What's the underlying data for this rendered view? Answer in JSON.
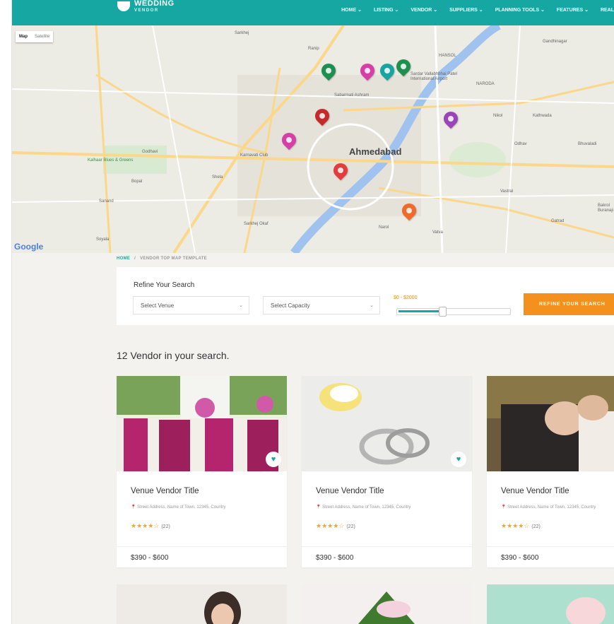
{
  "brand": {
    "name": "WEDDING",
    "sub": "VENDOR"
  },
  "nav": [
    {
      "label": "HOME ⌄"
    },
    {
      "label": "LISTING ⌄"
    },
    {
      "label": "VENDOR ⌄"
    },
    {
      "label": "SUPPLIERS ⌄"
    },
    {
      "label": "PLANNING TOOLS ⌄"
    },
    {
      "label": "FEATURES ⌄"
    },
    {
      "label": "REAL"
    }
  ],
  "map": {
    "toggle": {
      "map": "Map",
      "satellite": "Satellite"
    },
    "city": "Ahmedabad",
    "places": [
      "Sarkhej Okaf",
      "Karnavati Club",
      "Sabarmati Ashram",
      "Sardar Vallabhbhai Patel International Airport",
      "NARODA",
      "HANSOL",
      "Kathwada",
      "Bhuvaladi",
      "Vastral",
      "Gatrad",
      "Bakrol Buranaji",
      "Sanand",
      "Kalhaar Blues & Greens",
      "Godhavi",
      "Bopal",
      "Shela",
      "Soyala",
      "Sarkhej",
      "Gandhinagar",
      "Ranip",
      "Odhav",
      "Nikol",
      "Vatva",
      "Narol"
    ],
    "attribution": "Google",
    "pins": [
      {
        "color": "#1e8f4e",
        "icon": "pin-icon"
      },
      {
        "color": "#d63fa6",
        "icon": "pin-icon"
      },
      {
        "color": "#18a4a0",
        "icon": "pin-icon"
      },
      {
        "color": "#1e8f4e",
        "icon": "pin-icon"
      },
      {
        "color": "#c52a2a",
        "icon": "pin-icon"
      },
      {
        "color": "#9b44b8",
        "icon": "pin-icon"
      },
      {
        "color": "#d63fa6",
        "icon": "pin-icon"
      },
      {
        "color": "#e23c3c",
        "icon": "pin-icon"
      },
      {
        "color": "#f06a28",
        "icon": "pin-icon"
      }
    ]
  },
  "breadcrumb": {
    "home": "HOME",
    "sep": "/",
    "current": "VENDOR TOP MAP TEMPLATE"
  },
  "search": {
    "title": "Refine Your Search",
    "venue": "Select Venue",
    "capacity": "Select Capacity",
    "price_label": "$0 - $2000",
    "price_fill": 0.4,
    "button": "REFINE YOUR SEARCH"
  },
  "results": {
    "count_text": "12 Vendor in your search."
  },
  "cards": [
    {
      "title": "Venue Vendor Title",
      "address": "📍 Street Address, Name of Town, 12345, Country",
      "stars": "★★★★☆",
      "reviews": "(22)",
      "price": "$390 - $600",
      "favorite": true
    },
    {
      "title": "Venue Vendor Title",
      "address": "📍 Street Address, Name of Town, 12345, Country",
      "stars": "★★★★☆",
      "reviews": "(22)",
      "price": "$390 - $600",
      "favorite": true
    },
    {
      "title": "Venue Vendor Title",
      "address": "📍 Street Address, Name of Town, 12345, Country",
      "stars": "★★★★☆",
      "reviews": "(22)",
      "price": "$390 - $600",
      "favorite": false
    }
  ],
  "colors": {
    "brand": "#16a7a3",
    "accent": "#f4911e",
    "star": "#f4a623"
  }
}
